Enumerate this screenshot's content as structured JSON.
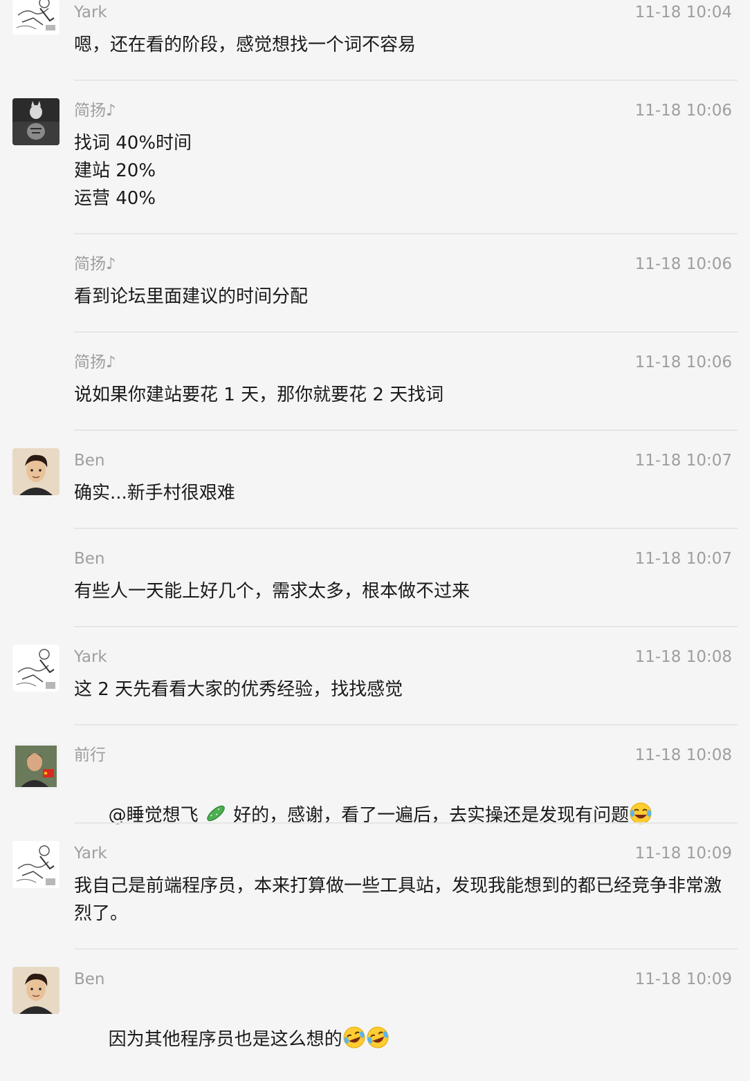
{
  "messages": [
    {
      "sender": "Yark",
      "avatar": "yark-sketch-avatar",
      "time": "11-18 10:04",
      "text": "嗯，还在看的阶段，感觉想找一个词不容易"
    },
    {
      "sender": "简扬♪",
      "avatar": "cat-tiger-reflection-avatar",
      "time": "11-18 10:06",
      "text": "找词 40%时间\n建站 20%\n运营 40%"
    },
    {
      "sender": "简扬♪",
      "avatar": "",
      "time": "11-18 10:06",
      "text": "看到论坛里面建议的时间分配"
    },
    {
      "sender": "简扬♪",
      "avatar": "",
      "time": "11-18 10:06",
      "text": "说如果你建站要花 1 天，那你就要花 2 天找词"
    },
    {
      "sender": "Ben",
      "avatar": "ben-cartoon-avatar",
      "time": "11-18 10:07",
      "text": "确实...新手村很艰难"
    },
    {
      "sender": "Ben",
      "avatar": "",
      "time": "11-18 10:07",
      "text": "有些人一天能上好几个，需求太多，根本做不过来"
    },
    {
      "sender": "Yark",
      "avatar": "yark-sketch-avatar",
      "time": "11-18 10:08",
      "text": "这 2 天先看看大家的优秀经验，找找感觉"
    },
    {
      "sender": "前行",
      "avatar": "qianxing-photo-avatar",
      "time": "11-18 10:08",
      "text_before": "@睡觉想飞 ",
      "text_after": " 好的，感谢，看了一遍后，去实操还是发现有问题",
      "emoji_mid": "cucumber-emoji",
      "emoji_end": "laughing-tears-emoji"
    },
    {
      "sender": "Yark",
      "avatar": "yark-sketch-avatar",
      "time": "11-18 10:09",
      "text": "我自己是前端程序员，本来打算做一些工具站，发现我能想到的都已经竞争非常激烈了。"
    },
    {
      "sender": "Ben",
      "avatar": "ben-cartoon-avatar",
      "time": "11-18 10:09",
      "text": "因为其他程序员也是这么想的",
      "emoji_end": "rolling-laughing-emoji"
    }
  ]
}
